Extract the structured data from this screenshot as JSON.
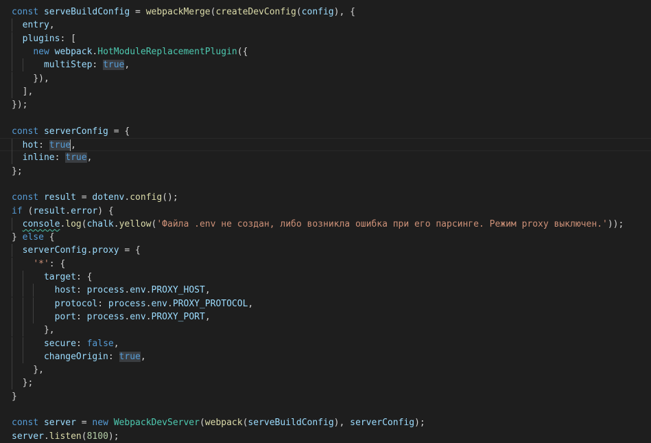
{
  "editor": {
    "lines": [
      [
        [
          "kw",
          "const"
        ],
        [
          "pu",
          " "
        ],
        [
          "pr",
          "serveBuildConfig"
        ],
        [
          "pu",
          " = "
        ],
        [
          "fn",
          "webpackMerge"
        ],
        [
          "pu",
          "("
        ],
        [
          "fn",
          "createDevConfig"
        ],
        [
          "pu",
          "("
        ],
        [
          "pr",
          "config"
        ],
        [
          "pu",
          "), {"
        ]
      ],
      [
        [
          "pu",
          "  "
        ],
        [
          "pr",
          "entry"
        ],
        [
          "pu",
          ","
        ]
      ],
      [
        [
          "pu",
          "  "
        ],
        [
          "pr",
          "plugins"
        ],
        [
          "pu",
          ": ["
        ]
      ],
      [
        [
          "pu",
          "    "
        ],
        [
          "kw",
          "new"
        ],
        [
          "pu",
          " "
        ],
        [
          "pr",
          "webpack"
        ],
        [
          "pu",
          "."
        ],
        [
          "ty",
          "HotModuleReplacementPlugin"
        ],
        [
          "pu",
          "({"
        ]
      ],
      [
        [
          "pu",
          "      "
        ],
        [
          "pr",
          "multiStep"
        ],
        [
          "pu",
          ": "
        ],
        [
          "kwh",
          "true"
        ],
        [
          "pu",
          ","
        ]
      ],
      [
        [
          "pu",
          "    }),"
        ]
      ],
      [
        [
          "pu",
          "  ],"
        ]
      ],
      [
        [
          "pu",
          "});"
        ]
      ],
      [],
      [
        [
          "kw",
          "const"
        ],
        [
          "pu",
          " "
        ],
        [
          "pr",
          "serverConfig"
        ],
        [
          "pu",
          " = {"
        ]
      ],
      [
        [
          "pu",
          "  "
        ],
        [
          "pr",
          "hot"
        ],
        [
          "pu",
          ": "
        ],
        [
          "kwh",
          "true"
        ],
        [
          "cursor",
          ""
        ],
        [
          "pu",
          ","
        ]
      ],
      [
        [
          "pu",
          "  "
        ],
        [
          "pr",
          "inline"
        ],
        [
          "pu",
          ": "
        ],
        [
          "kwh",
          "true"
        ],
        [
          "pu",
          ","
        ]
      ],
      [
        [
          "pu",
          "};"
        ]
      ],
      [],
      [
        [
          "kw",
          "const"
        ],
        [
          "pu",
          " "
        ],
        [
          "pr",
          "result"
        ],
        [
          "pu",
          " = "
        ],
        [
          "pr",
          "dotenv"
        ],
        [
          "pu",
          "."
        ],
        [
          "fn",
          "config"
        ],
        [
          "pu",
          "();"
        ]
      ],
      [
        [
          "kw",
          "if"
        ],
        [
          "pu",
          " ("
        ],
        [
          "pr",
          "result"
        ],
        [
          "pu",
          "."
        ],
        [
          "pr",
          "error"
        ],
        [
          "pu",
          ") {"
        ]
      ],
      [
        [
          "pu",
          "  "
        ],
        [
          "prs",
          "console"
        ],
        [
          "pu",
          "."
        ],
        [
          "fn",
          "log"
        ],
        [
          "pu",
          "("
        ],
        [
          "pr",
          "chalk"
        ],
        [
          "pu",
          "."
        ],
        [
          "fn",
          "yellow"
        ],
        [
          "pu",
          "("
        ],
        [
          "st",
          "'Файла .env не создан, либо возникла ошибка при его парсинге. Режим proxy выключен.'"
        ],
        [
          "pu",
          "));"
        ]
      ],
      [
        [
          "pu",
          "} "
        ],
        [
          "kw",
          "else"
        ],
        [
          "pu",
          " {"
        ]
      ],
      [
        [
          "pu",
          "  "
        ],
        [
          "pr",
          "serverConfig"
        ],
        [
          "pu",
          "."
        ],
        [
          "pr",
          "proxy"
        ],
        [
          "pu",
          " = {"
        ]
      ],
      [
        [
          "pu",
          "    "
        ],
        [
          "st",
          "'*'"
        ],
        [
          "pu",
          ": {"
        ]
      ],
      [
        [
          "pu",
          "      "
        ],
        [
          "pr",
          "target"
        ],
        [
          "pu",
          ": {"
        ]
      ],
      [
        [
          "pu",
          "        "
        ],
        [
          "pr",
          "host"
        ],
        [
          "pu",
          ": "
        ],
        [
          "pr",
          "process"
        ],
        [
          "pu",
          "."
        ],
        [
          "pr",
          "env"
        ],
        [
          "pu",
          "."
        ],
        [
          "pr",
          "PROXY_HOST"
        ],
        [
          "pu",
          ","
        ]
      ],
      [
        [
          "pu",
          "        "
        ],
        [
          "pr",
          "protocol"
        ],
        [
          "pu",
          ": "
        ],
        [
          "pr",
          "process"
        ],
        [
          "pu",
          "."
        ],
        [
          "pr",
          "env"
        ],
        [
          "pu",
          "."
        ],
        [
          "pr",
          "PROXY_PROTOCOL"
        ],
        [
          "pu",
          ","
        ]
      ],
      [
        [
          "pu",
          "        "
        ],
        [
          "pr",
          "port"
        ],
        [
          "pu",
          ": "
        ],
        [
          "pr",
          "process"
        ],
        [
          "pu",
          "."
        ],
        [
          "pr",
          "env"
        ],
        [
          "pu",
          "."
        ],
        [
          "pr",
          "PROXY_PORT"
        ],
        [
          "pu",
          ","
        ]
      ],
      [
        [
          "pu",
          "      },"
        ]
      ],
      [
        [
          "pu",
          "      "
        ],
        [
          "pr",
          "secure"
        ],
        [
          "pu",
          ": "
        ],
        [
          "kw",
          "false"
        ],
        [
          "pu",
          ","
        ]
      ],
      [
        [
          "pu",
          "      "
        ],
        [
          "pr",
          "changeOrigin"
        ],
        [
          "pu",
          ": "
        ],
        [
          "kwh",
          "true"
        ],
        [
          "pu",
          ","
        ]
      ],
      [
        [
          "pu",
          "    },"
        ]
      ],
      [
        [
          "pu",
          "  };"
        ]
      ],
      [
        [
          "pu",
          "}"
        ]
      ],
      [],
      [
        [
          "kw",
          "const"
        ],
        [
          "pu",
          " "
        ],
        [
          "pr",
          "server"
        ],
        [
          "pu",
          " = "
        ],
        [
          "kw",
          "new"
        ],
        [
          "pu",
          " "
        ],
        [
          "ty",
          "WebpackDevServer"
        ],
        [
          "pu",
          "("
        ],
        [
          "fn",
          "webpack"
        ],
        [
          "pu",
          "("
        ],
        [
          "pr",
          "serveBuildConfig"
        ],
        [
          "pu",
          "), "
        ],
        [
          "pr",
          "serverConfig"
        ],
        [
          "pu",
          ");"
        ]
      ],
      [
        [
          "pr",
          "server"
        ],
        [
          "pu",
          "."
        ],
        [
          "fn",
          "listen"
        ],
        [
          "pu",
          "("
        ],
        [
          "nu",
          "8100"
        ],
        [
          "pu",
          ");"
        ]
      ]
    ],
    "guides": [
      [],
      [
        0
      ],
      [
        0
      ],
      [
        0
      ],
      [
        0,
        2
      ],
      [
        0
      ],
      [
        0
      ],
      [],
      [],
      [],
      [
        0
      ],
      [
        0
      ],
      [],
      [],
      [],
      [],
      [
        0
      ],
      [],
      [
        0
      ],
      [
        0
      ],
      [
        0,
        2
      ],
      [
        0,
        2,
        4
      ],
      [
        0,
        2,
        4
      ],
      [
        0,
        2,
        4
      ],
      [
        0,
        2
      ],
      [
        0,
        2
      ],
      [
        0,
        2
      ],
      [
        0
      ],
      [
        0
      ],
      [],
      [],
      [],
      []
    ],
    "current_line": 10
  }
}
